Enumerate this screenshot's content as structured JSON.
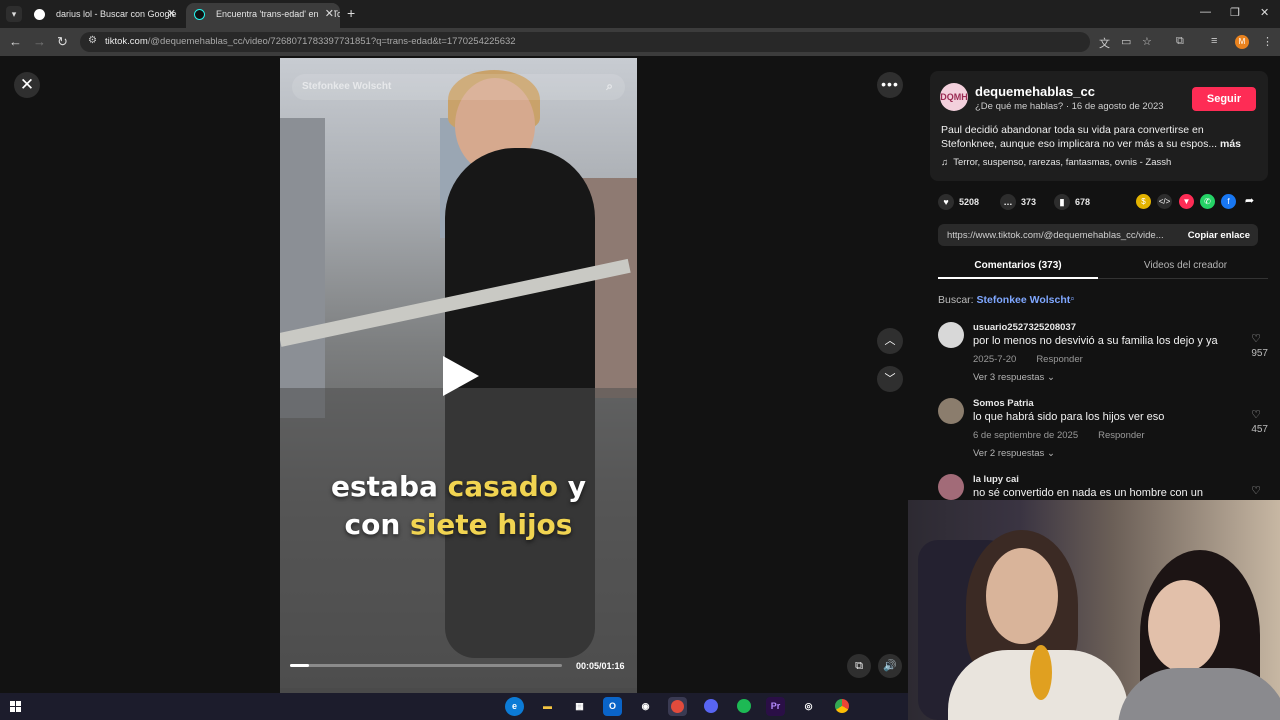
{
  "browser": {
    "tabs": [
      {
        "title": "darius lol - Buscar con Google",
        "active": false
      },
      {
        "title": "Encuentra 'trans-edad' en TikTok",
        "active": true
      }
    ],
    "url_domain": "tiktok.com",
    "url_path": "/@dequemehablas_cc/video/7268071783397731851?q=trans-edad&t=1770254225632",
    "profile_initial": "M"
  },
  "video": {
    "search_placeholder": "Stefonkee Wolscht",
    "caption_line1_a": "estaba ",
    "caption_line1_b": "casado",
    "caption_line1_c": " y",
    "caption_line2_a": "con ",
    "caption_line2_b": "siete hijos",
    "time": "00:05/01:16",
    "progress": 0.07
  },
  "author": {
    "avatar_text": "DQMH",
    "name": "dequemehablas_cc",
    "meta": "¿De qué me hablas? · 16 de agosto de 2023",
    "follow_label": "Seguir",
    "description": "Paul decidió abandonar toda su vida para convertirse en Stefonknee, aunque eso implicara no ver más a su espos...",
    "more_label": "más",
    "music": "Terror, suspenso, rarezas, fantasmas, ovnis - Zassh"
  },
  "stats": {
    "likes": "5208",
    "comments": "373",
    "saves": "678"
  },
  "link": {
    "url": "https://www.tiktok.com/@dequemehablas_cc/vide...",
    "copy_label": "Copiar enlace"
  },
  "tabs": {
    "comments": "Comentarios (373)",
    "videos": "Videos del creador"
  },
  "search": {
    "label": "Buscar:",
    "term": "Stefonkee Wolscht"
  },
  "comments": [
    {
      "user": "usuario2527325208037",
      "text": "por lo menos no desvivió a su familia los dejo y ya",
      "date": "2025-7-20",
      "reply": "Responder",
      "replies": "Ver 3 respuestas",
      "likes": "957"
    },
    {
      "user": "Somos Patria",
      "text": "lo que habrá sido para los hijos ver eso",
      "date": "6 de septiembre de 2025",
      "reply": "Responder",
      "replies": "Ver 2 respuestas",
      "likes": "457"
    },
    {
      "user": "la lupy cai",
      "text": "no sé convertido en nada es un hombre con un"
    }
  ],
  "colors": {
    "accent": "#fe2c55",
    "caption_highlight": "#f1d451",
    "link": "#7fa7ff"
  }
}
